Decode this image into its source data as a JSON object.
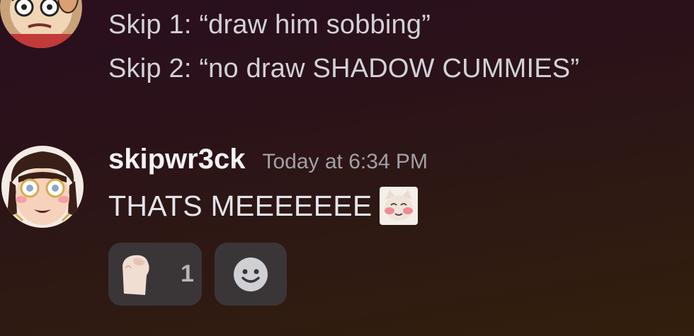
{
  "previous_message": {
    "lines": [
      "Skip 1: “draw him sobbing”",
      "Skip 2: “no draw SHADOW CUMMIES”"
    ]
  },
  "message": {
    "username": "skipwr3ck",
    "timestamp": "Today at 6:34 PM",
    "text": "THATS MEEEEEEE",
    "inline_emoji": "blushing-cat-emoji"
  },
  "reactions": [
    {
      "emoji": "cat-paw-emoji",
      "count": "1"
    }
  ],
  "add_reaction_icon": "smile-icon",
  "colors": {
    "username": "#f2f2f5",
    "timestamp": "#a3a0a6",
    "reaction_bg": "#3a3638"
  }
}
